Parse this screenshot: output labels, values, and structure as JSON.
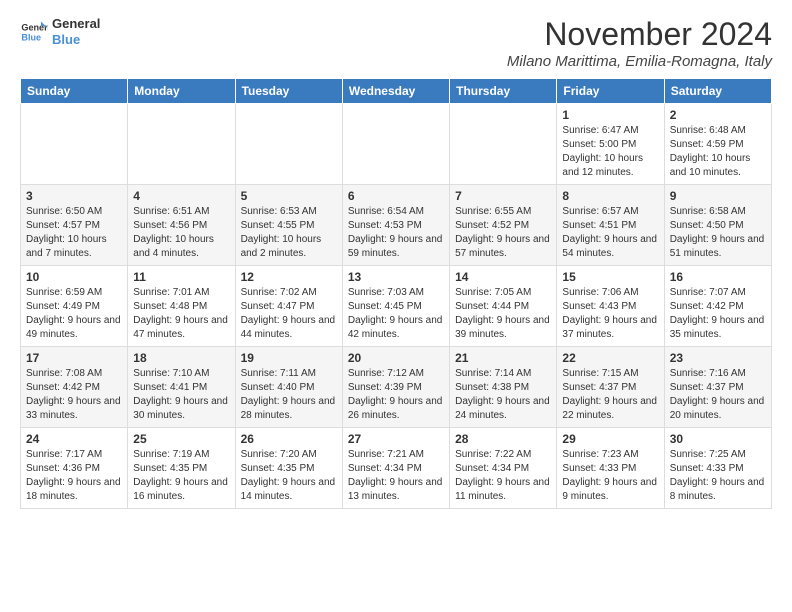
{
  "logo": {
    "text_general": "General",
    "text_blue": "Blue"
  },
  "header": {
    "month": "November 2024",
    "location": "Milano Marittima, Emilia-Romagna, Italy"
  },
  "days_of_week": [
    "Sunday",
    "Monday",
    "Tuesday",
    "Wednesday",
    "Thursday",
    "Friday",
    "Saturday"
  ],
  "weeks": [
    [
      {
        "day": "",
        "info": ""
      },
      {
        "day": "",
        "info": ""
      },
      {
        "day": "",
        "info": ""
      },
      {
        "day": "",
        "info": ""
      },
      {
        "day": "",
        "info": ""
      },
      {
        "day": "1",
        "info": "Sunrise: 6:47 AM\nSunset: 5:00 PM\nDaylight: 10 hours and 12 minutes."
      },
      {
        "day": "2",
        "info": "Sunrise: 6:48 AM\nSunset: 4:59 PM\nDaylight: 10 hours and 10 minutes."
      }
    ],
    [
      {
        "day": "3",
        "info": "Sunrise: 6:50 AM\nSunset: 4:57 PM\nDaylight: 10 hours and 7 minutes."
      },
      {
        "day": "4",
        "info": "Sunrise: 6:51 AM\nSunset: 4:56 PM\nDaylight: 10 hours and 4 minutes."
      },
      {
        "day": "5",
        "info": "Sunrise: 6:53 AM\nSunset: 4:55 PM\nDaylight: 10 hours and 2 minutes."
      },
      {
        "day": "6",
        "info": "Sunrise: 6:54 AM\nSunset: 4:53 PM\nDaylight: 9 hours and 59 minutes."
      },
      {
        "day": "7",
        "info": "Sunrise: 6:55 AM\nSunset: 4:52 PM\nDaylight: 9 hours and 57 minutes."
      },
      {
        "day": "8",
        "info": "Sunrise: 6:57 AM\nSunset: 4:51 PM\nDaylight: 9 hours and 54 minutes."
      },
      {
        "day": "9",
        "info": "Sunrise: 6:58 AM\nSunset: 4:50 PM\nDaylight: 9 hours and 51 minutes."
      }
    ],
    [
      {
        "day": "10",
        "info": "Sunrise: 6:59 AM\nSunset: 4:49 PM\nDaylight: 9 hours and 49 minutes."
      },
      {
        "day": "11",
        "info": "Sunrise: 7:01 AM\nSunset: 4:48 PM\nDaylight: 9 hours and 47 minutes."
      },
      {
        "day": "12",
        "info": "Sunrise: 7:02 AM\nSunset: 4:47 PM\nDaylight: 9 hours and 44 minutes."
      },
      {
        "day": "13",
        "info": "Sunrise: 7:03 AM\nSunset: 4:45 PM\nDaylight: 9 hours and 42 minutes."
      },
      {
        "day": "14",
        "info": "Sunrise: 7:05 AM\nSunset: 4:44 PM\nDaylight: 9 hours and 39 minutes."
      },
      {
        "day": "15",
        "info": "Sunrise: 7:06 AM\nSunset: 4:43 PM\nDaylight: 9 hours and 37 minutes."
      },
      {
        "day": "16",
        "info": "Sunrise: 7:07 AM\nSunset: 4:42 PM\nDaylight: 9 hours and 35 minutes."
      }
    ],
    [
      {
        "day": "17",
        "info": "Sunrise: 7:08 AM\nSunset: 4:42 PM\nDaylight: 9 hours and 33 minutes."
      },
      {
        "day": "18",
        "info": "Sunrise: 7:10 AM\nSunset: 4:41 PM\nDaylight: 9 hours and 30 minutes."
      },
      {
        "day": "19",
        "info": "Sunrise: 7:11 AM\nSunset: 4:40 PM\nDaylight: 9 hours and 28 minutes."
      },
      {
        "day": "20",
        "info": "Sunrise: 7:12 AM\nSunset: 4:39 PM\nDaylight: 9 hours and 26 minutes."
      },
      {
        "day": "21",
        "info": "Sunrise: 7:14 AM\nSunset: 4:38 PM\nDaylight: 9 hours and 24 minutes."
      },
      {
        "day": "22",
        "info": "Sunrise: 7:15 AM\nSunset: 4:37 PM\nDaylight: 9 hours and 22 minutes."
      },
      {
        "day": "23",
        "info": "Sunrise: 7:16 AM\nSunset: 4:37 PM\nDaylight: 9 hours and 20 minutes."
      }
    ],
    [
      {
        "day": "24",
        "info": "Sunrise: 7:17 AM\nSunset: 4:36 PM\nDaylight: 9 hours and 18 minutes."
      },
      {
        "day": "25",
        "info": "Sunrise: 7:19 AM\nSunset: 4:35 PM\nDaylight: 9 hours and 16 minutes."
      },
      {
        "day": "26",
        "info": "Sunrise: 7:20 AM\nSunset: 4:35 PM\nDaylight: 9 hours and 14 minutes."
      },
      {
        "day": "27",
        "info": "Sunrise: 7:21 AM\nSunset: 4:34 PM\nDaylight: 9 hours and 13 minutes."
      },
      {
        "day": "28",
        "info": "Sunrise: 7:22 AM\nSunset: 4:34 PM\nDaylight: 9 hours and 11 minutes."
      },
      {
        "day": "29",
        "info": "Sunrise: 7:23 AM\nSunset: 4:33 PM\nDaylight: 9 hours and 9 minutes."
      },
      {
        "day": "30",
        "info": "Sunrise: 7:25 AM\nSunset: 4:33 PM\nDaylight: 9 hours and 8 minutes."
      }
    ]
  ]
}
